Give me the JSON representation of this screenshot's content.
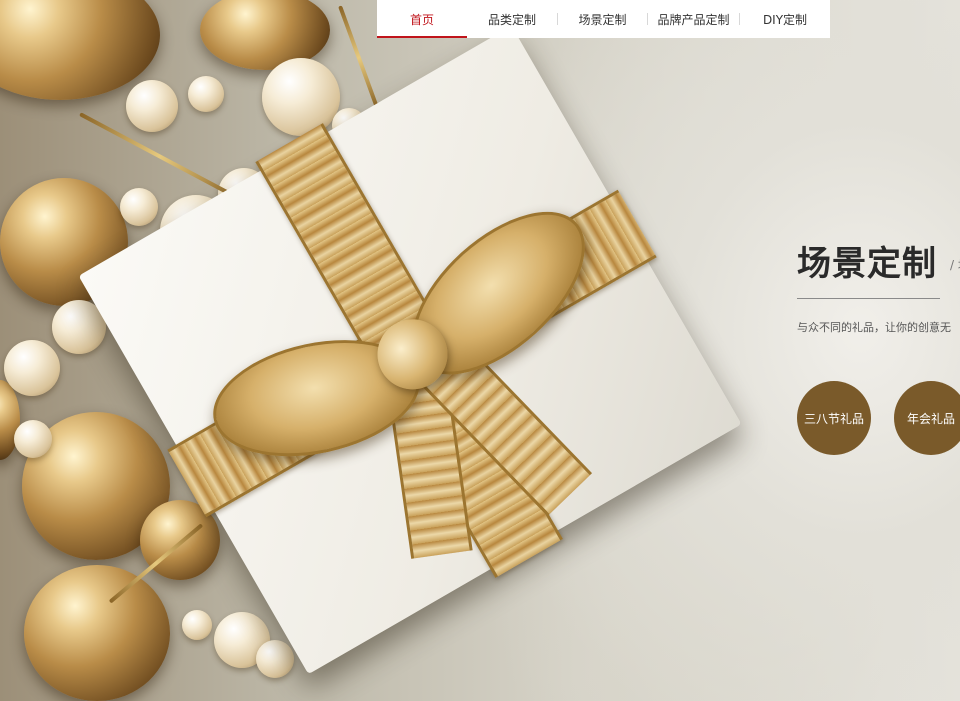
{
  "nav": {
    "items": [
      {
        "label": "首页",
        "active": true
      },
      {
        "label": "品类定制",
        "active": false
      },
      {
        "label": "场景定制",
        "active": false
      },
      {
        "label": "品牌产品定制",
        "active": false
      },
      {
        "label": "DIY定制",
        "active": false
      }
    ],
    "active_color": "#c0141b"
  },
  "scene": {
    "title": "场景定制",
    "slash": "/ 场",
    "description": "与众不同的礼品，让你的创意无",
    "buttons": [
      {
        "label": "三八节礼品"
      },
      {
        "label": "年会礼品"
      }
    ],
    "button_color": "#7a5a2a"
  },
  "hero": {
    "image": "gift-box-with-gold-ribbon-and-christmas-ornaments"
  }
}
